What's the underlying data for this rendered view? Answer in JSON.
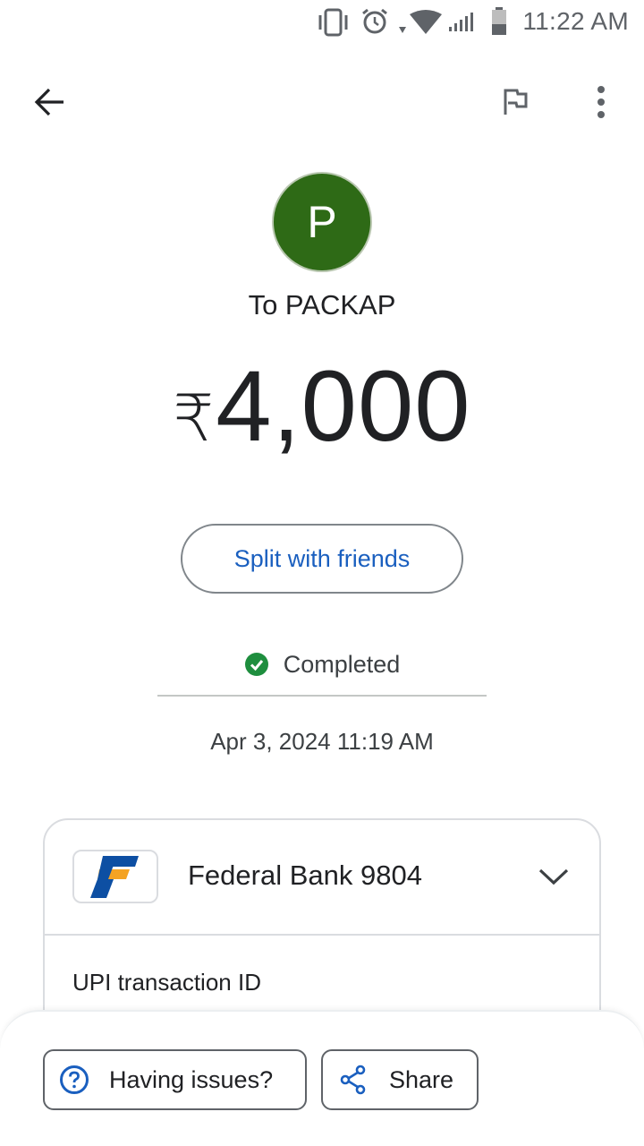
{
  "status_bar": {
    "time": "11:22 AM",
    "icons": [
      "vibrate-icon",
      "alarm-icon",
      "wifi-icon",
      "signal-icon",
      "battery-icon"
    ]
  },
  "app_bar": {
    "icons": [
      "back-arrow-icon",
      "flag-icon",
      "more-vert-icon"
    ]
  },
  "payee": {
    "avatar_letter": "P",
    "avatar_color": "#2e6a16",
    "label": "To PACKAP"
  },
  "amount": {
    "currency": "₹",
    "value": "4,000"
  },
  "split_button": {
    "label": "Split with friends",
    "color": "#1a5fbf"
  },
  "transaction_status": {
    "label": "Completed",
    "icon": "check-circle-icon",
    "color": "#1e8e3e"
  },
  "datetime": "Apr 3, 2024 11:19 AM",
  "bank_card": {
    "bank_name": "Federal Bank 9804",
    "logo_icon": "federal-bank-logo",
    "upi_label": "UPI transaction ID"
  },
  "bottom_actions": {
    "issues_label": "Having issues?",
    "share_label": "Share"
  }
}
